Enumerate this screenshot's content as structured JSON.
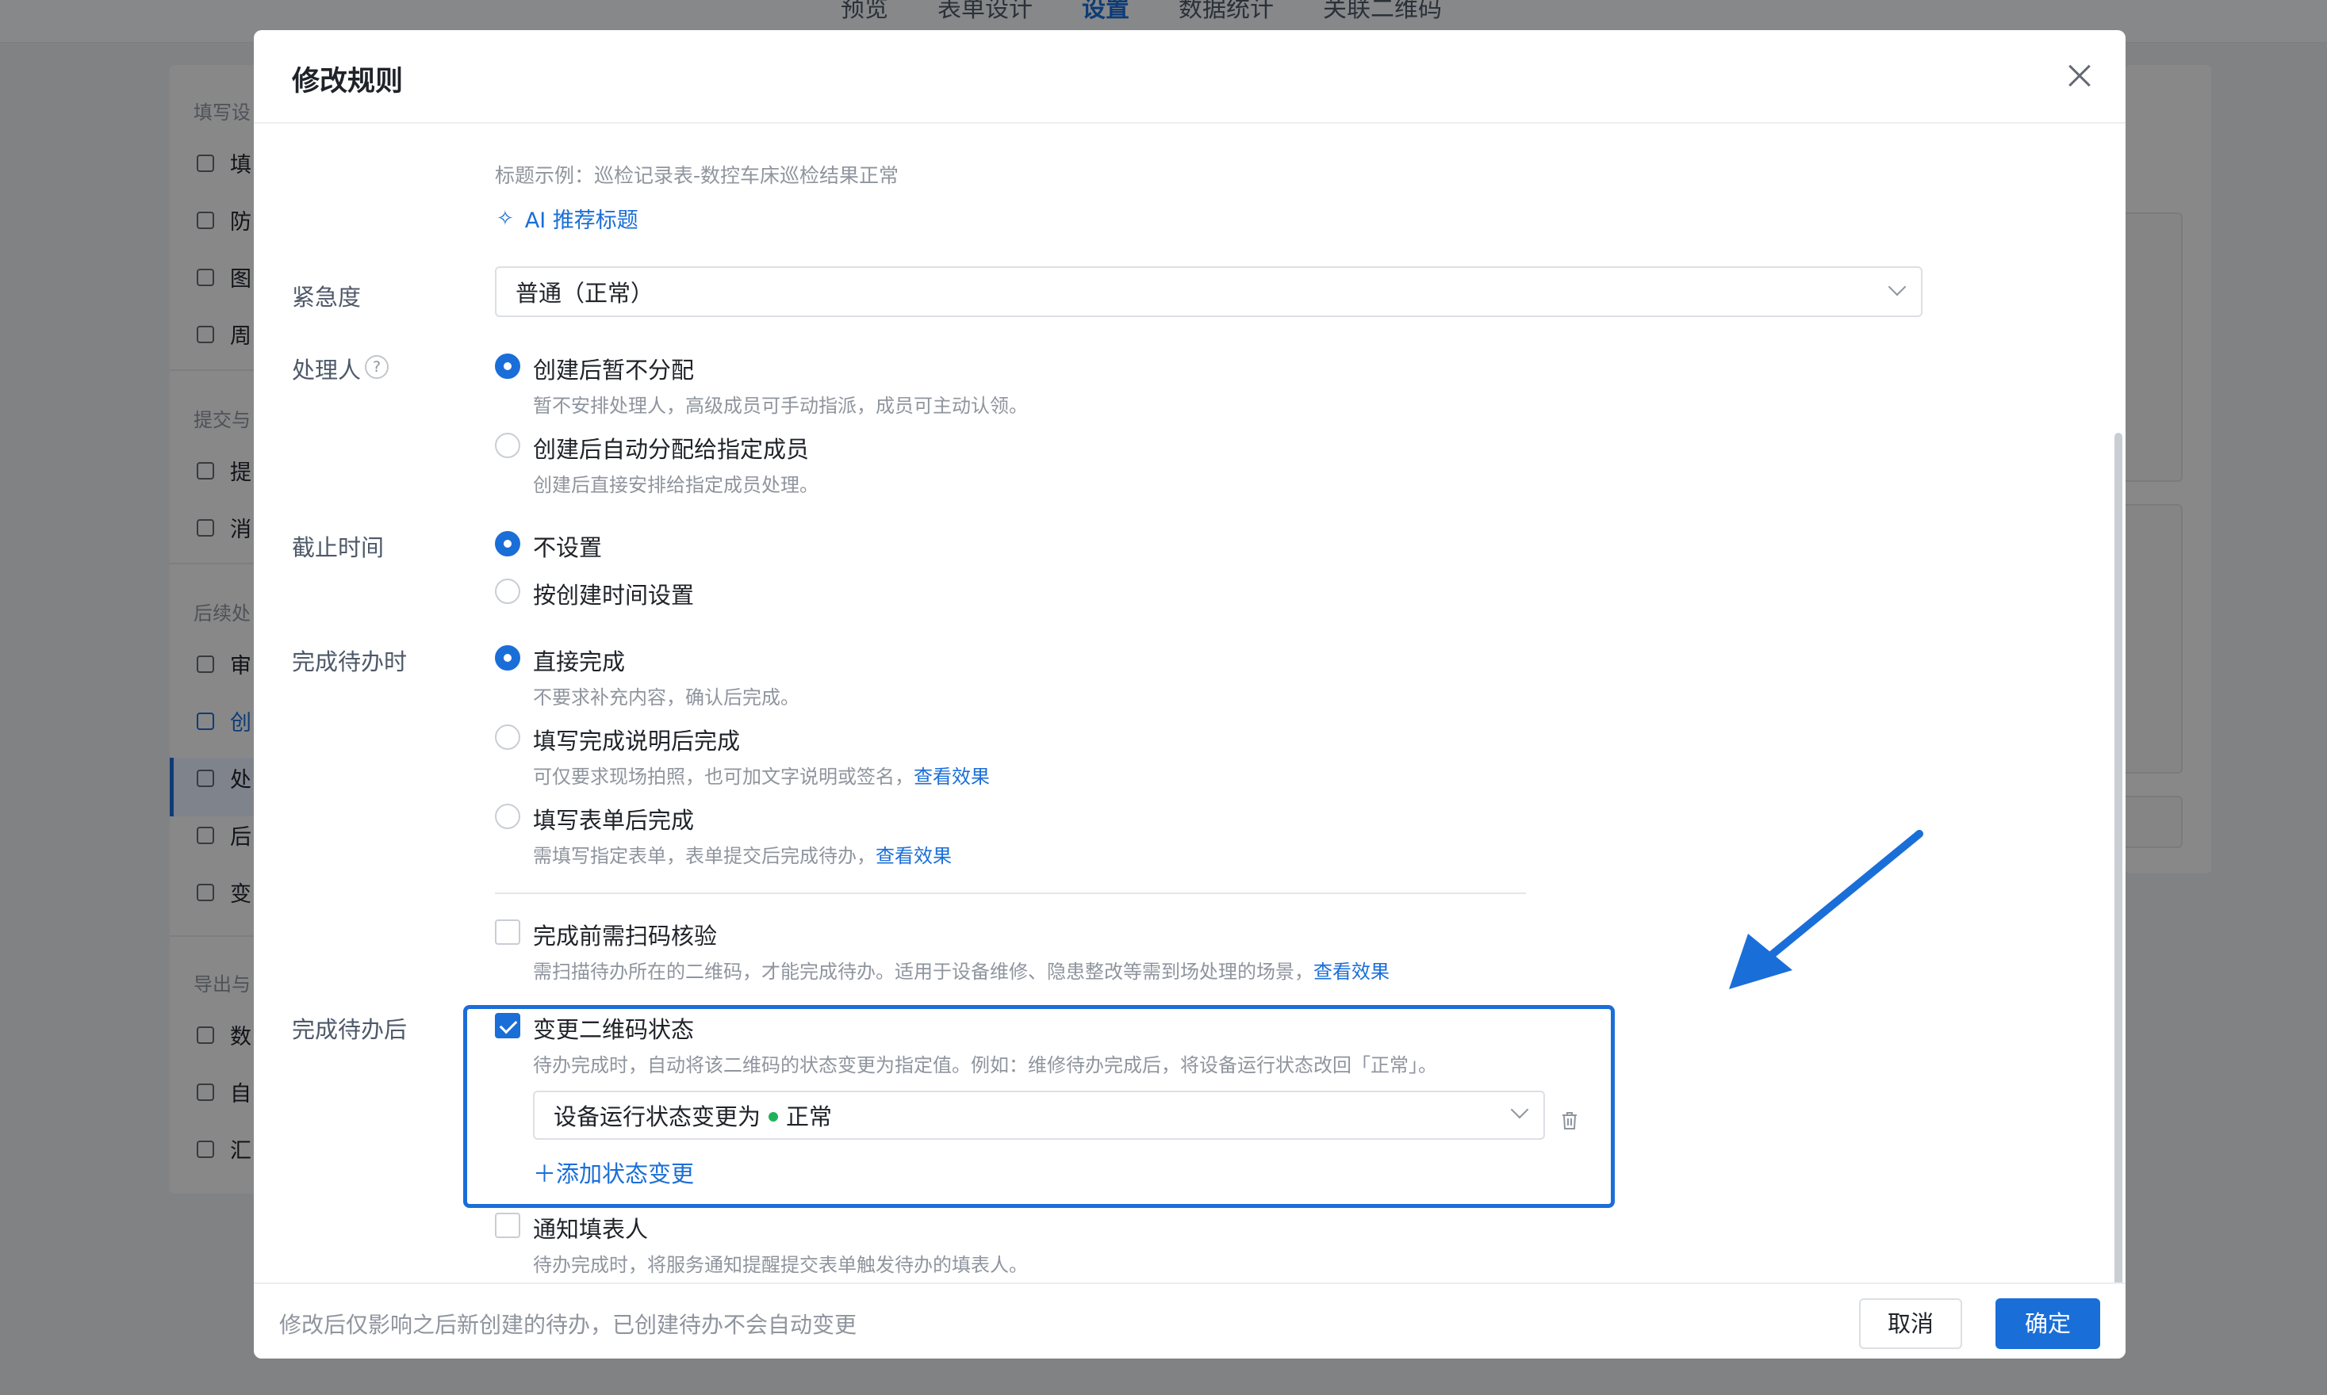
{
  "background": {
    "nav_tabs": [
      "预览",
      "表单设计",
      "设置",
      "数据统计",
      "关联二维码"
    ],
    "active_tab_index": 2,
    "sidebar": {
      "sections": [
        "填写设",
        "提交与",
        "后续处",
        "导出与"
      ],
      "items": [
        "填",
        "防",
        "图",
        "周",
        "提",
        "消",
        "审",
        "创",
        "处",
        "后",
        "变",
        "数",
        "自",
        "汇"
      ]
    }
  },
  "modal": {
    "title": "修改规则",
    "title_example": "标题示例：巡检记录表-数控车床巡检结果正常",
    "ai_link": "AI 推荐标题",
    "urgency": {
      "label": "紧急度",
      "value": "普通（正常）"
    },
    "handler": {
      "label": "处理人",
      "help": "?",
      "options": [
        {
          "label": "创建后暂不分配",
          "desc": "暂不安排处理人，高级成员可手动指派，成员可主动认领。",
          "selected": true
        },
        {
          "label": "创建后自动分配给指定成员",
          "desc": "创建后直接安排给指定成员处理。",
          "selected": false
        }
      ]
    },
    "deadline": {
      "label": "截止时间",
      "options": [
        {
          "label": "不设置",
          "selected": true
        },
        {
          "label": "按创建时间设置",
          "selected": false
        }
      ]
    },
    "on_complete": {
      "label": "完成待办时",
      "options": [
        {
          "label": "直接完成",
          "desc": "不要求补充内容，确认后完成。",
          "selected": true
        },
        {
          "label": "填写完成说明后完成",
          "desc": "可仅要求现场拍照，也可加文字说明或签名，",
          "link": "查看效果",
          "selected": false
        },
        {
          "label": "填写表单后完成",
          "desc": "需填写指定表单，表单提交后完成待办，",
          "link": "查看效果",
          "selected": false
        }
      ],
      "scan_check": {
        "label": "完成前需扫码核验",
        "desc": "需扫描待办所在的二维码，才能完成待办。适用于设备维修、隐患整改等需到场处理的场景，",
        "link": "查看效果",
        "checked": false
      }
    },
    "after_complete": {
      "label": "完成待办后",
      "change_status": {
        "label": "变更二维码状态",
        "desc": "待办完成时，自动将该二维码的状态变更为指定值。例如：维修待办完成后，将设备运行状态改回「正常」。",
        "checked": true,
        "select_prefix": "设备运行状态变更为",
        "select_value": "正常",
        "status_color": "#1fb25a",
        "add_link": "＋添加状态变更"
      },
      "notify": {
        "label": "通知填表人",
        "desc": "待办完成时，将服务通知提醒提交表单触发待办的填表人。",
        "checked": false
      }
    },
    "footer": {
      "note": "修改后仅影响之后新创建的待办，已创建待办不会自动变更",
      "cancel": "取消",
      "ok": "确定"
    }
  },
  "colors": {
    "accent": "#1a6ed8",
    "overlay": "rgba(0,0,0,0.45)"
  },
  "icons": [
    "close-icon",
    "ai-sparkle-icon",
    "help-icon",
    "chevron-down-icon",
    "trash-icon",
    "arrow-annotation"
  ]
}
